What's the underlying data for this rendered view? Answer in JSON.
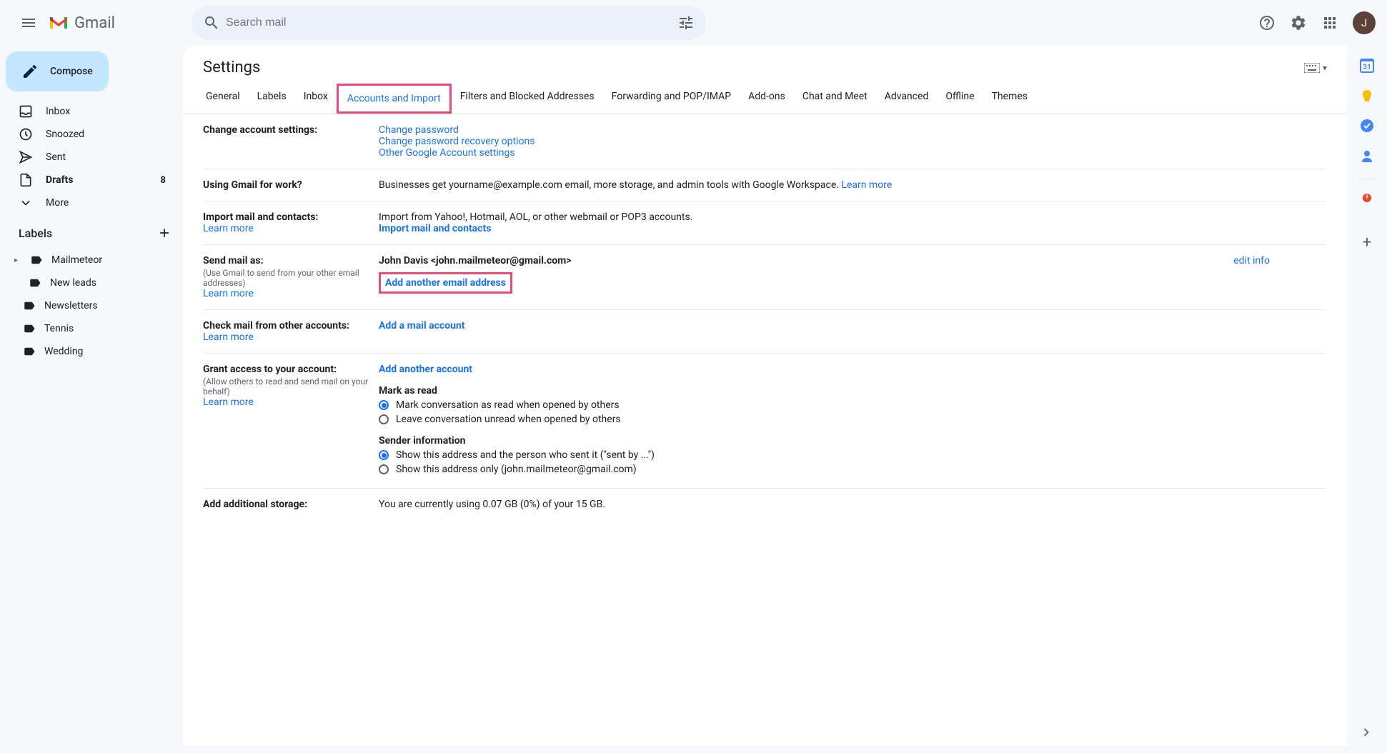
{
  "header": {
    "app_name": "Gmail",
    "search_placeholder": "Search mail",
    "avatar_initial": "J"
  },
  "sidebar": {
    "compose": "Compose",
    "nav": [
      {
        "label": "Inbox",
        "count": ""
      },
      {
        "label": "Snoozed",
        "count": ""
      },
      {
        "label": "Sent",
        "count": ""
      },
      {
        "label": "Drafts",
        "count": "8",
        "bold": true
      },
      {
        "label": "More",
        "count": ""
      }
    ],
    "labels_header": "Labels",
    "labels": [
      {
        "label": "Mailmeteor"
      },
      {
        "label": "New leads"
      },
      {
        "label": "Newsletters"
      },
      {
        "label": "Tennis"
      },
      {
        "label": "Wedding"
      }
    ]
  },
  "settings": {
    "title": "Settings",
    "tabs": [
      "General",
      "Labels",
      "Inbox",
      "Accounts and Import",
      "Filters and Blocked Addresses",
      "Forwarding and POP/IMAP",
      "Add-ons",
      "Chat and Meet",
      "Advanced",
      "Offline",
      "Themes"
    ],
    "rows": {
      "change_account": {
        "title": "Change account settings:",
        "links": [
          "Change password",
          "Change password recovery options",
          "Other Google Account settings"
        ]
      },
      "gmail_work": {
        "title": "Using Gmail for work?",
        "text": "Businesses get yourname@example.com email, more storage, and admin tools with Google Workspace. ",
        "learn": "Learn more"
      },
      "import": {
        "title": "Import mail and contacts:",
        "learn": "Learn more",
        "text": "Import from Yahoo!, Hotmail, AOL, or other webmail or POP3 accounts.",
        "action": "Import mail and contacts"
      },
      "send_as": {
        "title": "Send mail as:",
        "subtitle": "(Use Gmail to send from your other email addresses)",
        "learn": "Learn more",
        "identity": "John Davis <john.mailmeteor@gmail.com>",
        "edit": "edit info",
        "action": "Add another email address"
      },
      "check_mail": {
        "title": "Check mail from other accounts:",
        "learn": "Learn more",
        "action": "Add a mail account"
      },
      "grant_access": {
        "title": "Grant access to your account:",
        "subtitle": "(Allow others to read and send mail on your behalf)",
        "learn": "Learn more",
        "action": "Add another account",
        "mark_header": "Mark as read",
        "mark_opt1": "Mark conversation as read when opened by others",
        "mark_opt2": "Leave conversation unread when opened by others",
        "sender_header": "Sender information",
        "sender_opt1": "Show this address and the person who sent it (\"sent by ...\")",
        "sender_opt2": "Show this address only (john.mailmeteor@gmail.com)"
      },
      "storage": {
        "title": "Add additional storage:",
        "text": "You are currently using 0.07 GB (0%) of your 15 GB."
      }
    }
  }
}
